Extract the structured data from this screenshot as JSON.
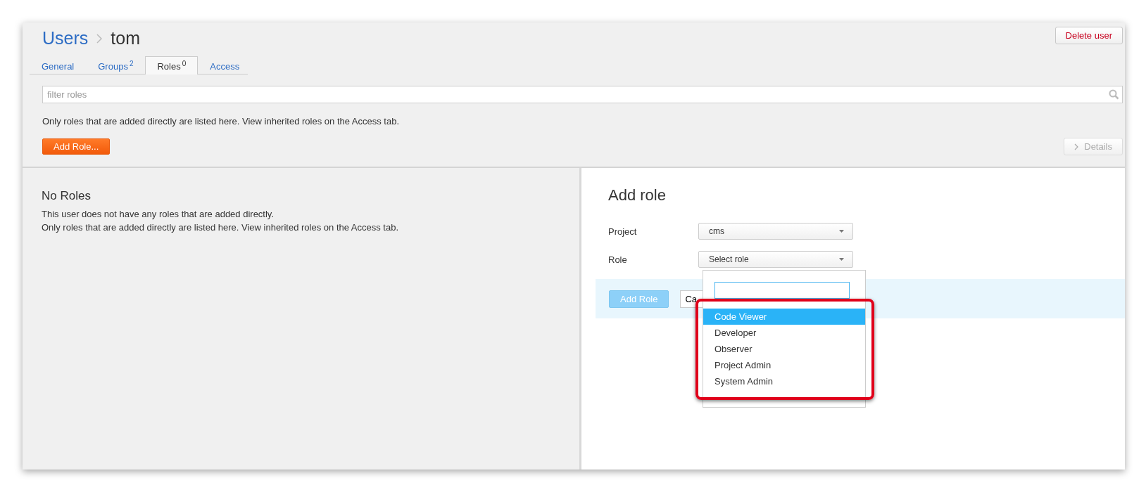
{
  "breadcrumb": {
    "parent": "Users",
    "current": "tom"
  },
  "delete_button": "Delete user",
  "tabs": [
    {
      "label": "General",
      "selected": false
    },
    {
      "label": "Groups",
      "count": "2",
      "selected": false
    },
    {
      "label": "Roles",
      "count": "0",
      "selected": true
    },
    {
      "label": "Access",
      "selected": false
    }
  ],
  "filter": {
    "placeholder": "filter roles"
  },
  "info": "Only roles that are added directly are listed here. View inherited roles on the Access tab.",
  "add_button": "Add Role...",
  "details_button": {
    "label": "Details",
    "disabled": true
  },
  "empty_state": {
    "title": "No Roles",
    "lines": [
      "This user does not have any roles that are added directly.",
      "Only roles that are added directly are listed here. View inherited roles on the Access tab."
    ]
  },
  "form": {
    "title": "Add role",
    "fields": [
      {
        "label": "Project",
        "value": "cms"
      },
      {
        "label": "Role",
        "value": "Select role"
      }
    ],
    "submit": {
      "label": "Add Role",
      "disabled": true
    },
    "cancel": "Ca"
  },
  "dropdown": {
    "options": [
      {
        "label": "Code Viewer",
        "selected": true
      },
      {
        "label": "Developer",
        "selected": false
      },
      {
        "label": "Observer",
        "selected": false
      },
      {
        "label": "Project Admin",
        "selected": false
      },
      {
        "label": "System Admin",
        "selected": false
      }
    ]
  }
}
